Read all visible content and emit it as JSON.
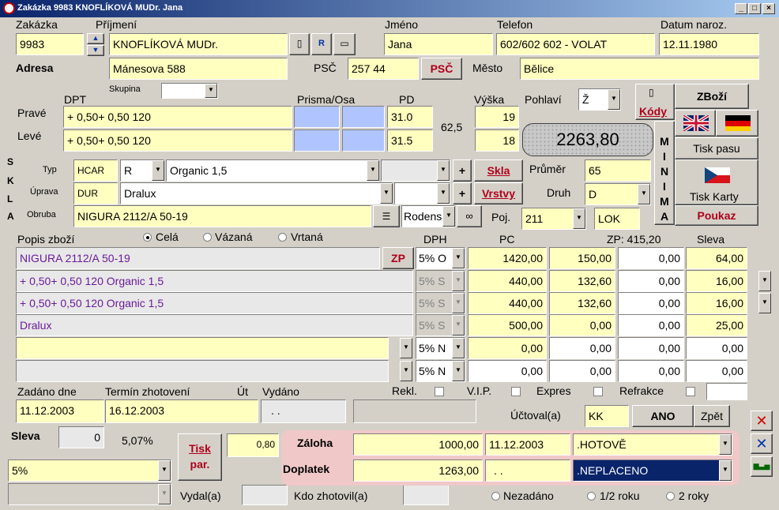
{
  "window": {
    "title": "Zakázka 9983 KNOFLÍKOVÁ MUDr. Jana"
  },
  "header": {
    "zakazka_label": "Zakázka",
    "zakazka": "9983",
    "prijmeni_label": "Příjmení",
    "prijmeni": "KNOFLÍKOVÁ MUDr.",
    "jmeno_label": "Jméno",
    "jmeno": "Jana",
    "telefon_label": "Telefon",
    "telefon": "602/602 602 - VOLAT",
    "datum_label": "Datum naroz.",
    "datum": "12.11.1980"
  },
  "address": {
    "label": "Adresa",
    "ulice": "Mánesova 588",
    "psc_label": "PSČ",
    "psc": "257 44",
    "psc_button": "PSČ",
    "mesto_label": "Město",
    "mesto": "Bělice"
  },
  "prescription": {
    "skupina_label": "Skupina",
    "dpt_label": "DPT",
    "prisma_label": "Prisma/Osa",
    "pd_label": "PD",
    "vyska_label": "Výška",
    "prave_label": "Pravé",
    "leve_label": "Levé",
    "prave_dpt": "+ 0,50+ 0,50 120",
    "leve_dpt": "+ 0,50+ 0,50 120",
    "prave_pd": "31.0",
    "leve_pd": "31.5",
    "pd_total": "62,5",
    "prave_vyska": "19",
    "leve_vyska": "18",
    "pohlavi_label": "Pohlaví",
    "pohlavi": "Ž"
  },
  "total": "2263,80",
  "side_buttons": {
    "kody": "Kódy",
    "zbozi": "ZBoží",
    "minima_letters": [
      "M",
      "I",
      "N",
      "I",
      "M",
      "A"
    ],
    "tisk_pasu": "Tisk pasu",
    "tisk_karty": "Tisk Karty",
    "poukaz": "Poukaz"
  },
  "skla": {
    "letters": [
      "S",
      "K",
      "L",
      "A"
    ],
    "typ_label": "Typ",
    "uprava_label": "Úprava",
    "obruba_label": "Obruba",
    "typ_code": "HCAR",
    "typ_r": "R",
    "typ_name": "Organic 1,5",
    "uprava_code": "DUR",
    "uprava_name": "Dralux",
    "obruba_name": "NIGURA 2112/A 50-19",
    "obruba_brand": "Rodens",
    "skla_button": "Skla",
    "vrstvy_button": "Vrstvy",
    "prumer_label": "Průměr",
    "prumer": "65",
    "druh_label": "Druh",
    "druh": "D",
    "poj_label": "Poj.",
    "poj": "211",
    "lok": "LOK"
  },
  "items": {
    "popis_label": "Popis zboží",
    "radio_cela": "Celá",
    "radio_vazana": "Vázaná",
    "radio_vrtana": "Vrtaná",
    "dph_label": "DPH",
    "pc_label": "PC",
    "zp_label": "ZP: 415,20",
    "sleva_label": "Sleva",
    "zp_button": "ZP",
    "rows": [
      {
        "popis": "NIGURA 2112/A 50-19",
        "dph": "5% O",
        "pc": "1420,00",
        "c2": "150,00",
        "c3": "0,00",
        "sleva": "64,00"
      },
      {
        "popis": "+ 0,50+ 0,50 120 Organic 1,5",
        "dph": "5% S",
        "pc": "440,00",
        "c2": "132,60",
        "c3": "0,00",
        "sleva": "16,00"
      },
      {
        "popis": "+ 0,50+ 0,50 120 Organic 1,5",
        "dph": "5% S",
        "pc": "440,00",
        "c2": "132,60",
        "c3": "0,00",
        "sleva": "16,00"
      },
      {
        "popis": "Dralux",
        "dph": "5% S",
        "pc": "500,00",
        "c2": "0,00",
        "c3": "0,00",
        "sleva": "25,00"
      },
      {
        "popis": "",
        "dph": "5% N",
        "pc": "0,00",
        "c2": "0,00",
        "c3": "0,00",
        "sleva": "0,00"
      },
      {
        "popis": "",
        "dph": "5% N",
        "pc": "0,00",
        "c2": "0,00",
        "c3": "0,00",
        "sleva": "0,00"
      }
    ]
  },
  "dates": {
    "zadano_label": "Zadáno dne",
    "zadano": "11.12.2003",
    "termin_label": "Termín zhotovení",
    "termin": "16.12.2003",
    "ut_label": "Út",
    "vydano_label": "Vydáno",
    "vydano": ". .",
    "rekl_label": "Rekl.",
    "vip_label": "V.I.P.",
    "expres_label": "Expres",
    "refrakce_label": "Refrakce"
  },
  "uctoval": {
    "label": "Účtoval(a)",
    "value": "KK",
    "ano": "ANO",
    "zpet": "Zpět"
  },
  "bottom": {
    "sleva_label": "Sleva",
    "sleva_value": "0",
    "percent": "5,07%",
    "tisk_par_1": "Tisk",
    "tisk_par_2": "par.",
    "koef": "0,80",
    "sleva_select": "5%",
    "vydal_label": "Vydal(a)",
    "kdo_label": "Kdo zhotovil(a)"
  },
  "payment": {
    "zaloha_label": "Záloha",
    "zaloha": "1000,00",
    "zaloha_date": "11.12.2003",
    "zaloha_type": ".HOTOVĚ",
    "doplatek_label": "Doplatek",
    "doplatek": "1263,00",
    "doplatek_date": ". .",
    "doplatek_type": ".NEPLACENO"
  },
  "warranty": {
    "nezadano": "Nezadáno",
    "pul_roku": "1/2 roku",
    "dva_roky": "2 roky"
  }
}
